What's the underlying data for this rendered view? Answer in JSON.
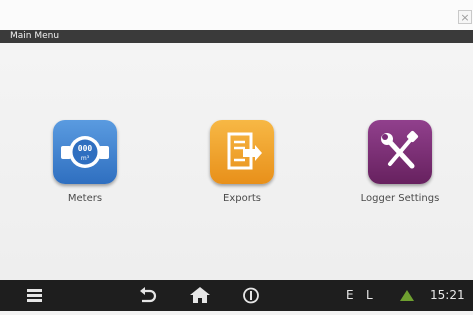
{
  "window": {
    "close_symbol": "×"
  },
  "titlebar": {
    "title": "Main Menu"
  },
  "tiles": [
    {
      "label": "Meters",
      "icon": "meter-icon",
      "color": "#3a7fd0"
    },
    {
      "label": "Exports",
      "icon": "export-document-icon",
      "color": "#f0a020"
    },
    {
      "label": "Logger Settings",
      "icon": "tools-icon",
      "color": "#7a2b78"
    }
  ],
  "meter_icon_text": {
    "line1": "000",
    "line2": "m³"
  },
  "taskbar": {
    "icons": [
      "menu-icon",
      "back-icon",
      "home-icon",
      "info-icon",
      "warning-icon"
    ],
    "status_e": "E",
    "status_l": "L",
    "clock": "15:21",
    "warning_color": "#6fa030"
  }
}
